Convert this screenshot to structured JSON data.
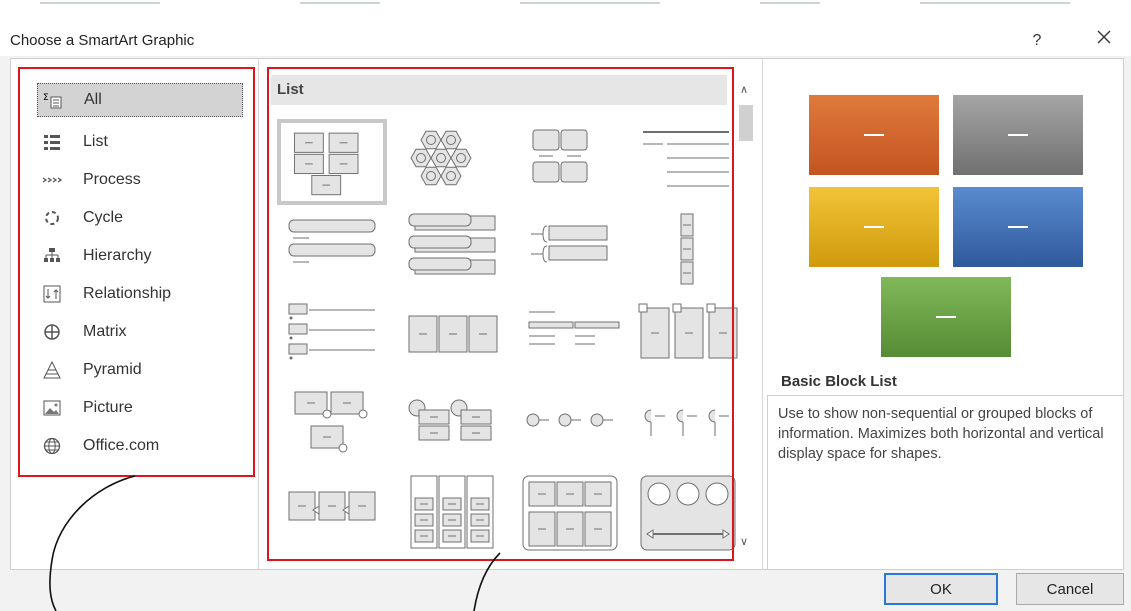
{
  "dialog": {
    "title": "Choose a SmartArt Graphic",
    "help_label": "?",
    "close_label": "×",
    "ok_label": "OK",
    "cancel_label": "Cancel"
  },
  "categories": [
    {
      "label": "All",
      "icon": "all-icon",
      "selected": true
    },
    {
      "label": "List",
      "icon": "list-icon"
    },
    {
      "label": "Process",
      "icon": "process-icon"
    },
    {
      "label": "Cycle",
      "icon": "cycle-icon"
    },
    {
      "label": "Hierarchy",
      "icon": "hierarchy-icon"
    },
    {
      "label": "Relationship",
      "icon": "relationship-icon"
    },
    {
      "label": "Matrix",
      "icon": "matrix-icon"
    },
    {
      "label": "Pyramid",
      "icon": "pyramid-icon"
    },
    {
      "label": "Picture",
      "icon": "picture-icon"
    },
    {
      "label": "Office.com",
      "icon": "globe-icon"
    }
  ],
  "gallery": {
    "section_header": "List",
    "items": [
      {
        "layout": "basic-block-list",
        "selected": true
      },
      {
        "layout": "hexagon-cluster"
      },
      {
        "layout": "grouped-blocks"
      },
      {
        "layout": "lined-list"
      },
      {
        "layout": "vertical-bullet-list"
      },
      {
        "layout": "stacked-list"
      },
      {
        "layout": "bracket-list"
      },
      {
        "layout": "vertical-box-list"
      },
      {
        "layout": "bulleted-lines"
      },
      {
        "layout": "horizontal-bullet-list"
      },
      {
        "layout": "table-list"
      },
      {
        "layout": "tab-list"
      },
      {
        "layout": "picture-caption-list"
      },
      {
        "layout": "circle-callout-list"
      },
      {
        "layout": "circle-line-list"
      },
      {
        "layout": "pin-list"
      },
      {
        "layout": "arrow-process-list"
      },
      {
        "layout": "column-list"
      },
      {
        "layout": "table-hierarchy"
      },
      {
        "layout": "circle-column-list"
      }
    ]
  },
  "preview": {
    "name": "Basic Block List",
    "description": "Use to show non-sequential or grouped blocks of information. Maximizes both horizontal and vertical display space for shapes.",
    "block_colors": [
      "#d5652a",
      "#8a8a8a",
      "#e7b41e",
      "#3f6fb4",
      "#6ea545"
    ]
  },
  "annotation_color": "#e0141e"
}
